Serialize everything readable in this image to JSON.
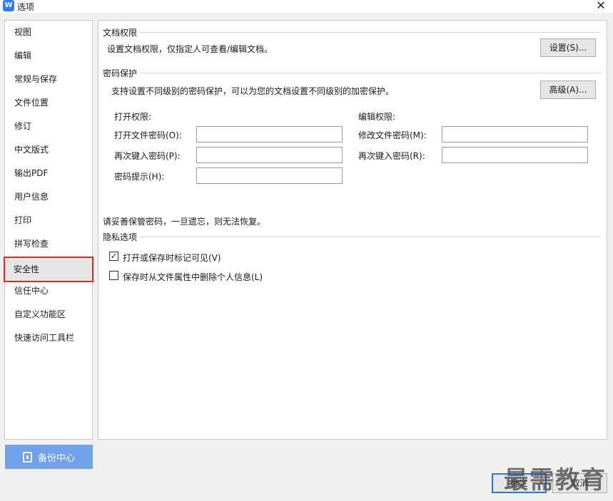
{
  "window": {
    "title": "选项",
    "logo": "W"
  },
  "sidebar": {
    "items": [
      {
        "label": "视图"
      },
      {
        "label": "编辑"
      },
      {
        "label": "常规与保存"
      },
      {
        "label": "文件位置"
      },
      {
        "label": "修订"
      },
      {
        "label": "中文版式"
      },
      {
        "label": "输出PDF"
      },
      {
        "label": "用户信息"
      },
      {
        "label": "打印"
      },
      {
        "label": "拼写检查"
      },
      {
        "label": "安全性"
      },
      {
        "label": "信任中心"
      },
      {
        "label": "自定义功能区"
      },
      {
        "label": "快速访问工具栏"
      }
    ],
    "active_index": 10,
    "backup_label": "备份中心"
  },
  "doc_permission": {
    "title": "文档权限",
    "desc": "设置文档权限，仅指定人可查看/编辑文档。",
    "button": "设置(S)..."
  },
  "password": {
    "title": "密码保护",
    "desc": "支持设置不同级别的密码保护，可以为您的文档设置不同级别的加密保护。",
    "button": "高级(A)...",
    "open_title": "打开权限:",
    "open_password": "打开文件密码(O):",
    "open_confirm": "再次键入密码(P):",
    "hint": "密码提示(H):",
    "edit_title": "编辑权限:",
    "edit_password": "修改文件密码(M):",
    "edit_confirm": "再次键入密码(R):",
    "note": "请妥善保管密码，一旦遗忘，则无法恢复。"
  },
  "privacy": {
    "title": "隐私选项",
    "option1": "打开或保存时标记可见(V)",
    "option1_checked": true,
    "option2": "保存时从文件属性中删除个人信息(L)",
    "option2_checked": false
  },
  "footer": {
    "ok": "确定",
    "cancel": "取消"
  },
  "watermark": "最需教育",
  "colors": {
    "accent": "#2f7cf6",
    "active_border": "#e0261f",
    "backup_bg": "#6fa2e8"
  }
}
